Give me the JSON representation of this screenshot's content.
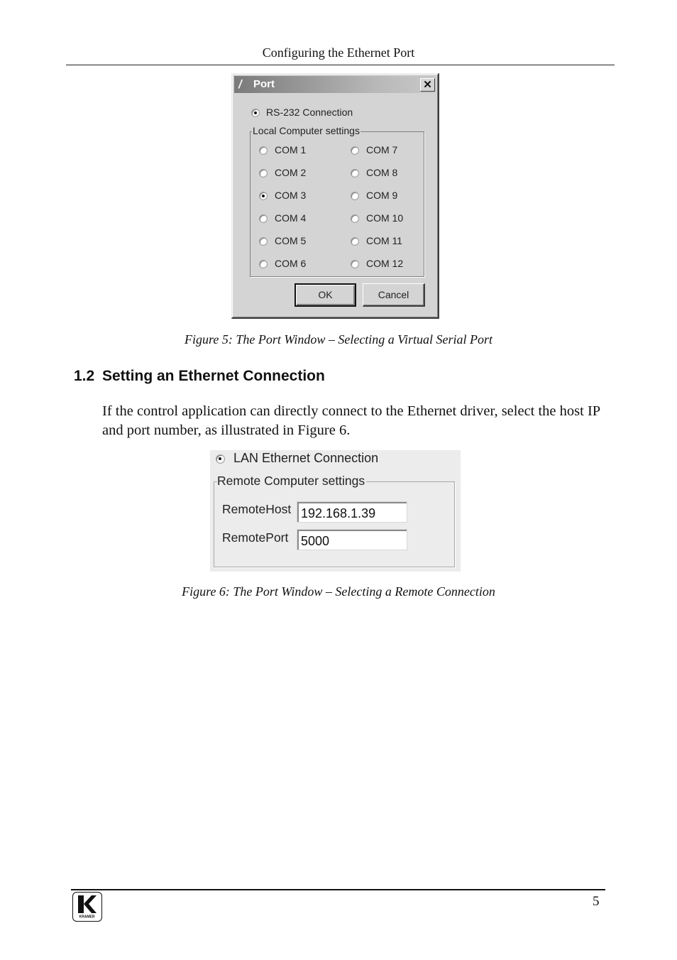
{
  "header": {
    "running_head": "Configuring the Ethernet Port"
  },
  "figure5": {
    "window": {
      "title": "Port",
      "close_label": "✕",
      "rs232": {
        "label": "RS-232 Connection",
        "checked": true
      },
      "group_label": "Local Computer settings",
      "ports": [
        {
          "label": "COM 1",
          "checked": false
        },
        {
          "label": "COM 2",
          "checked": false
        },
        {
          "label": "COM 3",
          "checked": true
        },
        {
          "label": "COM 4",
          "checked": false
        },
        {
          "label": "COM 5",
          "checked": false
        },
        {
          "label": "COM 6",
          "checked": false
        },
        {
          "label": "COM 7",
          "checked": false
        },
        {
          "label": "COM 8",
          "checked": false
        },
        {
          "label": "COM 9",
          "checked": false
        },
        {
          "label": "COM 10",
          "checked": false
        },
        {
          "label": "COM 11",
          "checked": false
        },
        {
          "label": "COM 12",
          "checked": false
        }
      ],
      "ok_label": "OK",
      "cancel_label": "Cancel"
    },
    "caption": "Figure 5: The Port Window – Selecting a Virtual Serial Port"
  },
  "section": {
    "number": "1.2",
    "title": "Setting an Ethernet Connection",
    "paragraph": "If the control application can directly connect to the Ethernet driver, select the host IP and port number, as illustrated in Figure 6."
  },
  "figure6": {
    "lan": {
      "label": "LAN Ethernet Connection",
      "checked": true
    },
    "group_label": "Remote Computer settings",
    "remote_host": {
      "label": "RemoteHost",
      "value": "192.168.1.39"
    },
    "remote_port": {
      "label": "RemotePort",
      "value": "5000"
    },
    "caption": "Figure 6: The Port Window – Selecting a Remote Connection"
  },
  "footer": {
    "page_number": "5",
    "logo_text": "KRAMER"
  }
}
